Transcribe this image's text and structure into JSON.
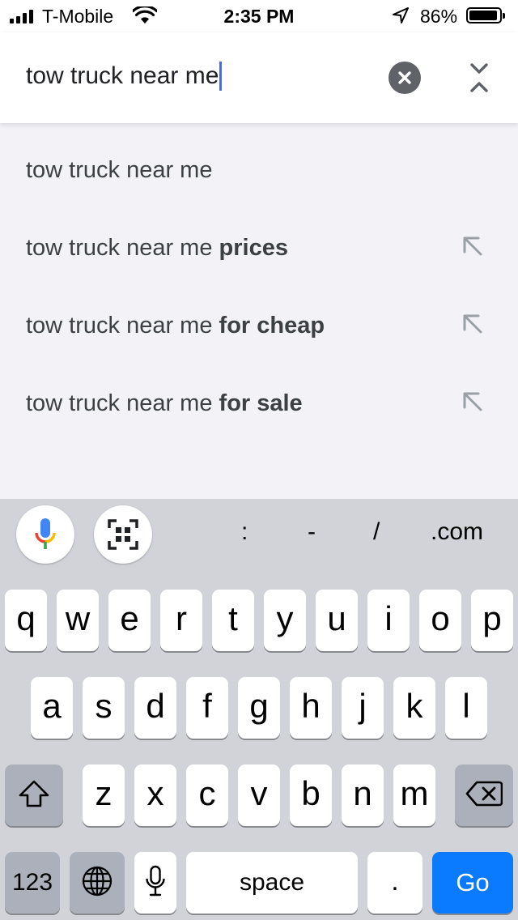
{
  "status_bar": {
    "carrier": "T-Mobile",
    "time": "2:35 PM",
    "battery_percent": "86%",
    "battery_level": 0.86,
    "signal_bars": 4
  },
  "search": {
    "query": "tow truck near me",
    "clear_icon": "close-circle-icon",
    "collapse_icon": "collapse-icon"
  },
  "suggestions": [
    {
      "base": "tow truck near me",
      "bold": "",
      "has_arrow": false
    },
    {
      "base": "tow truck near me ",
      "bold": "prices",
      "has_arrow": true
    },
    {
      "base": "tow truck near me ",
      "bold": "for cheap",
      "has_arrow": true
    },
    {
      "base": "tow truck near me ",
      "bold": "for sale",
      "has_arrow": true
    }
  ],
  "keyboard": {
    "toolbar": {
      "voice_icon": "microphone-icon",
      "scan_icon": "qr-scan-icon"
    },
    "shortcuts": [
      ":",
      "-",
      "/",
      ".com"
    ],
    "row1": [
      "q",
      "w",
      "e",
      "r",
      "t",
      "y",
      "u",
      "i",
      "o",
      "p"
    ],
    "row2": [
      "a",
      "s",
      "d",
      "f",
      "g",
      "h",
      "j",
      "k",
      "l"
    ],
    "row3": [
      "z",
      "x",
      "c",
      "v",
      "b",
      "n",
      "m"
    ],
    "bottom": {
      "numbers": "123",
      "space": "space",
      "period": ".",
      "go": "Go"
    },
    "colors": {
      "go": "#0a7aff",
      "background": "#d1d3d9"
    }
  }
}
